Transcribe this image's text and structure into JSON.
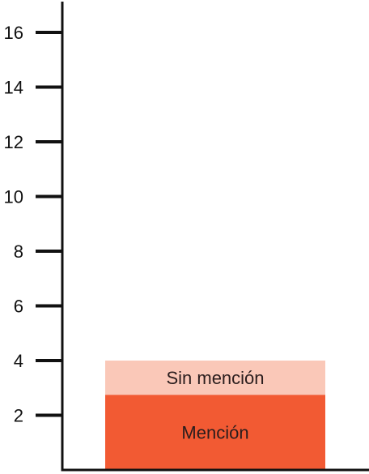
{
  "chart_data": {
    "type": "bar",
    "stacked": true,
    "title": "",
    "xlabel": "",
    "ylabel": "",
    "ylim": [
      0,
      17
    ],
    "yticks": [
      2,
      4,
      6,
      8,
      10,
      12,
      14,
      16
    ],
    "grid": false,
    "bar": {
      "segments": [
        {
          "label": "Mención",
          "value": 2.75,
          "color": "#f25a33"
        },
        {
          "label": "Sin mención",
          "value": 1.25,
          "color": "#fac8b8"
        }
      ]
    }
  }
}
